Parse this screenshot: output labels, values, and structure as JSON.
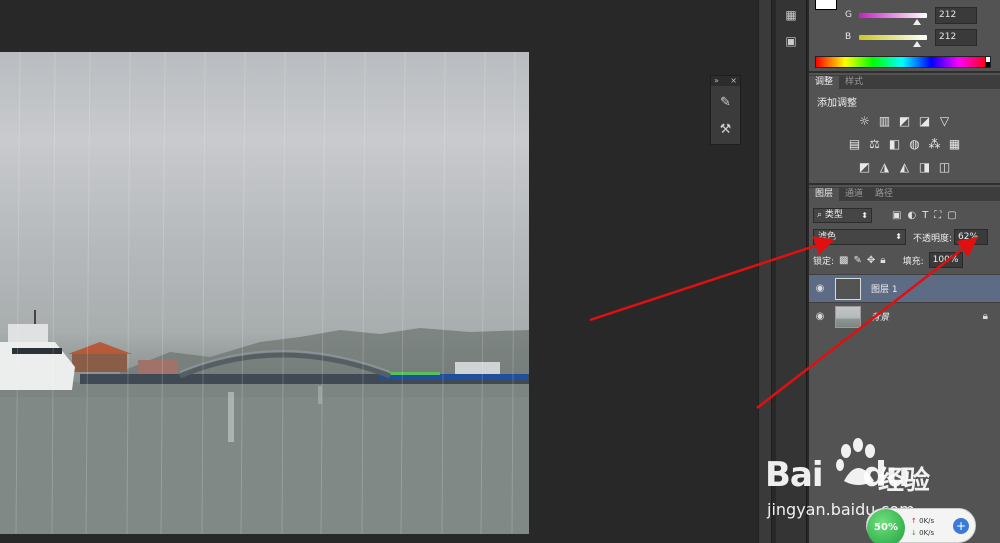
{
  "color_panel": {
    "g_label": "G",
    "g_value": "212",
    "b_label": "B",
    "b_value": "212",
    "g_track_color": "#c61fc6",
    "b_track_color": "#c8c81e"
  },
  "adjustments_panel": {
    "tabs": [
      "调整",
      "样式"
    ],
    "title": "添加调整",
    "row1_icons": [
      "brightness-contrast-icon",
      "levels-icon",
      "curves-icon",
      "exposure-icon",
      "vibrance-icon"
    ],
    "row2_icons": [
      "hue-saturation-icon",
      "color-balance-icon",
      "black-white-icon",
      "photo-filter-icon",
      "channel-mixer-icon",
      "color-lookup-icon"
    ],
    "row3_icons": [
      "invert-icon",
      "posterize-icon",
      "threshold-icon",
      "selective-color-icon",
      "gradient-map-icon"
    ]
  },
  "layers_panel": {
    "tabs": [
      "图层",
      "通道",
      "路径"
    ],
    "kind_filter": "类型",
    "blend_mode": "滤色",
    "opacity_label": "不透明度:",
    "opacity_value": "62%",
    "lock_label": "锁定:",
    "fill_label": "填充:",
    "fill_value": "100%",
    "layers": [
      {
        "name": "图层 1",
        "selected": true
      },
      {
        "name": "背景",
        "selected": false,
        "locked": true
      }
    ]
  },
  "watermark": {
    "brand": "Bai",
    "brand_tail": "du",
    "chinese": "经验",
    "url": "jingyan.baidu.com"
  },
  "speed_widget": {
    "percent": "50%",
    "up": "0K/s",
    "down": "0K/s"
  },
  "colors": {
    "arrow": "#e01010",
    "selected_layer": "#5d6b85",
    "panel_bg": "#535353"
  }
}
